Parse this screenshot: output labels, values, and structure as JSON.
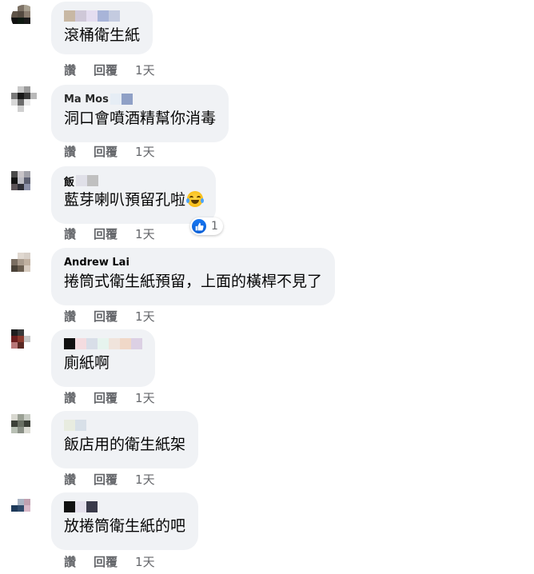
{
  "comments": [
    {
      "name_text": "",
      "text": "滾桶衛生紙",
      "actions": {
        "like": "讚",
        "reply": "回覆",
        "time": "1天"
      },
      "avatar_colors": [
        "#ffffff",
        "#7c7165",
        "#a8a090",
        "#ffffff",
        "#5f5448",
        "#544a40",
        "#8a7d6f",
        "#ffffff",
        "#111111",
        "#0f1a12",
        "#1a1a1a",
        "#ffffff",
        "#ffffff",
        "#ffffff",
        "#ffffff",
        "#ffffff"
      ],
      "name_colors": [
        "#c8b8a4",
        "#cfc8d8",
        "#e4ddf0",
        "#a8b4d8",
        "#c4cbe0"
      ]
    },
    {
      "name_text": "Ma Mos",
      "text": "洞口會噴酒精幫你消毒",
      "actions": {
        "like": "讚",
        "reply": "回覆",
        "time": "1天"
      },
      "avatar_colors": [
        "#ffffff",
        "#c8c8c8",
        "#9a9a9a",
        "#ffffff",
        "#7a7a7a",
        "#161616",
        "#3a3a3a",
        "#b9b9b9",
        "#d8d8d8",
        "#6a6a6a",
        "#e8e8e8",
        "#ffffff",
        "#ffffff",
        "#d0d0d0",
        "#ffffff",
        "#ffffff"
      ],
      "name_colors": [
        "#e6edf5",
        "#8fa0c6"
      ]
    },
    {
      "name_text": "飯",
      "text": "藍芽喇叭預留孔啦",
      "actions": {
        "like": "讚",
        "reply": "回覆",
        "time": "1天"
      },
      "reaction_count": "1",
      "avatar_colors": [
        "#4a4a4a",
        "#c8c4c8",
        "#a0a0a8",
        "#ffffff",
        "#141414",
        "#bdbdc4",
        "#5b5e70",
        "#ffffff",
        "#5c5458",
        "#2e2e36",
        "#8b90a8",
        "#ffffff",
        "#ffffff",
        "#ffffff",
        "#ffffff",
        "#ffffff"
      ],
      "name_colors": [
        "#e0e0e8",
        "#c0c0c0"
      ]
    },
    {
      "name_text": "Andrew Lai",
      "text": "捲筒式衛生紙預留，上面的橫桿不見了",
      "actions": {
        "like": "讚",
        "reply": "回覆",
        "time": "1天"
      },
      "avatar_colors": [
        "#ffffff",
        "#e0d8d0",
        "#d8d0c8",
        "#ffffff",
        "#7a6e62",
        "#a89a8c",
        "#c0b0a0",
        "#ffffff",
        "#4a4238",
        "#6b5e50",
        "#d8ccc0",
        "#ffffff",
        "#ffffff",
        "#ffffff",
        "#ffffff",
        "#ffffff"
      ],
      "name_colors": []
    },
    {
      "name_text": "",
      "text": "廁紙啊",
      "actions": {
        "like": "讚",
        "reply": "回覆",
        "time": "1天"
      },
      "avatar_colors": [
        "#1e1e1e",
        "#3a3a3a",
        "#ffffff",
        "#ffffff",
        "#6b1e1e",
        "#8a3a2e",
        "#c8c8c8",
        "#ffffff",
        "#b87878",
        "#5a2a24",
        "#ffffff",
        "#ffffff",
        "#ffffff",
        "#ffffff",
        "#ffffff",
        "#ffffff"
      ],
      "name_colors": [
        "#111111",
        "#f4dce0",
        "#d8dee8",
        "#e6f4ee",
        "#f0e4dc",
        "#f0d8c8",
        "#dcd0e4"
      ]
    },
    {
      "name_text": "",
      "text": "飯店用的衛生紙架",
      "actions": {
        "like": "讚",
        "reply": "回覆",
        "time": "1天"
      },
      "avatar_colors": [
        "#d8d8d0",
        "#9aa094",
        "#c8ccc4",
        "#ffffff",
        "#3c4038",
        "#6a7064",
        "#3a3e36",
        "#ffffff",
        "#b8c0b4",
        "#8a9086",
        "#dcdcd4",
        "#ffffff",
        "#ffffff",
        "#ffffff",
        "#ffffff",
        "#ffffff"
      ],
      "name_colors": [
        "#e8ece0",
        "#d8e0e8"
      ]
    },
    {
      "name_text": "",
      "text": "放捲筒衛生紙的吧",
      "actions": {
        "like": "讚",
        "reply": "回覆",
        "time": "1天"
      },
      "avatar_colors": [
        "#ffffff",
        "#aab4c4",
        "#c0a0b0",
        "#ffffff",
        "#1e3a5a",
        "#2e4a6a",
        "#d8b8c8",
        "#ffffff",
        "#ffffff",
        "#ffffff",
        "#ffffff",
        "#ffffff",
        "#ffffff",
        "#ffffff",
        "#ffffff",
        "#ffffff"
      ],
      "name_colors": [
        "#111111",
        "#e4e0ec",
        "#3a3a4a"
      ]
    }
  ]
}
